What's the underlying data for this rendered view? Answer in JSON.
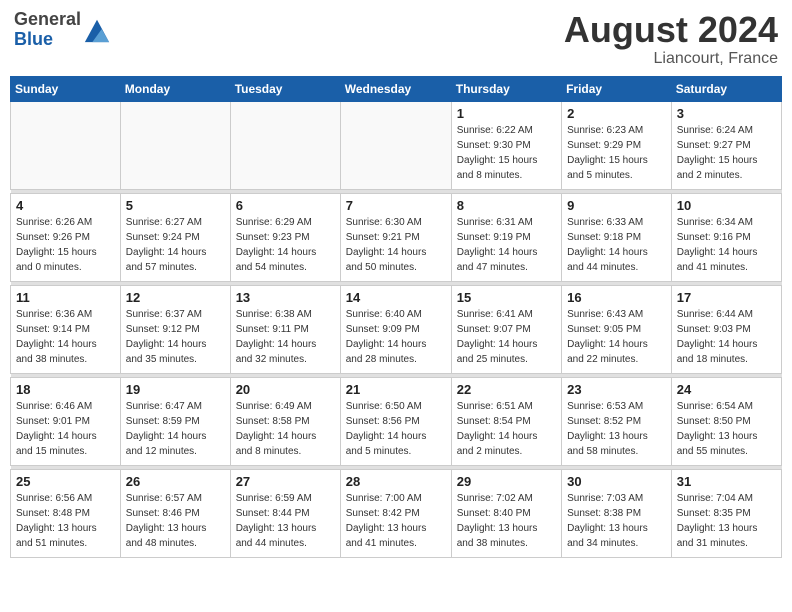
{
  "header": {
    "logo_line1": "General",
    "logo_line2": "Blue",
    "month_year": "August 2024",
    "location": "Liancourt, France"
  },
  "days_of_week": [
    "Sunday",
    "Monday",
    "Tuesday",
    "Wednesday",
    "Thursday",
    "Friday",
    "Saturday"
  ],
  "weeks": [
    [
      {
        "day": "",
        "info": ""
      },
      {
        "day": "",
        "info": ""
      },
      {
        "day": "",
        "info": ""
      },
      {
        "day": "",
        "info": ""
      },
      {
        "day": "1",
        "info": "Sunrise: 6:22 AM\nSunset: 9:30 PM\nDaylight: 15 hours\nand 8 minutes."
      },
      {
        "day": "2",
        "info": "Sunrise: 6:23 AM\nSunset: 9:29 PM\nDaylight: 15 hours\nand 5 minutes."
      },
      {
        "day": "3",
        "info": "Sunrise: 6:24 AM\nSunset: 9:27 PM\nDaylight: 15 hours\nand 2 minutes."
      }
    ],
    [
      {
        "day": "4",
        "info": "Sunrise: 6:26 AM\nSunset: 9:26 PM\nDaylight: 15 hours\nand 0 minutes."
      },
      {
        "day": "5",
        "info": "Sunrise: 6:27 AM\nSunset: 9:24 PM\nDaylight: 14 hours\nand 57 minutes."
      },
      {
        "day": "6",
        "info": "Sunrise: 6:29 AM\nSunset: 9:23 PM\nDaylight: 14 hours\nand 54 minutes."
      },
      {
        "day": "7",
        "info": "Sunrise: 6:30 AM\nSunset: 9:21 PM\nDaylight: 14 hours\nand 50 minutes."
      },
      {
        "day": "8",
        "info": "Sunrise: 6:31 AM\nSunset: 9:19 PM\nDaylight: 14 hours\nand 47 minutes."
      },
      {
        "day": "9",
        "info": "Sunrise: 6:33 AM\nSunset: 9:18 PM\nDaylight: 14 hours\nand 44 minutes."
      },
      {
        "day": "10",
        "info": "Sunrise: 6:34 AM\nSunset: 9:16 PM\nDaylight: 14 hours\nand 41 minutes."
      }
    ],
    [
      {
        "day": "11",
        "info": "Sunrise: 6:36 AM\nSunset: 9:14 PM\nDaylight: 14 hours\nand 38 minutes."
      },
      {
        "day": "12",
        "info": "Sunrise: 6:37 AM\nSunset: 9:12 PM\nDaylight: 14 hours\nand 35 minutes."
      },
      {
        "day": "13",
        "info": "Sunrise: 6:38 AM\nSunset: 9:11 PM\nDaylight: 14 hours\nand 32 minutes."
      },
      {
        "day": "14",
        "info": "Sunrise: 6:40 AM\nSunset: 9:09 PM\nDaylight: 14 hours\nand 28 minutes."
      },
      {
        "day": "15",
        "info": "Sunrise: 6:41 AM\nSunset: 9:07 PM\nDaylight: 14 hours\nand 25 minutes."
      },
      {
        "day": "16",
        "info": "Sunrise: 6:43 AM\nSunset: 9:05 PM\nDaylight: 14 hours\nand 22 minutes."
      },
      {
        "day": "17",
        "info": "Sunrise: 6:44 AM\nSunset: 9:03 PM\nDaylight: 14 hours\nand 18 minutes."
      }
    ],
    [
      {
        "day": "18",
        "info": "Sunrise: 6:46 AM\nSunset: 9:01 PM\nDaylight: 14 hours\nand 15 minutes."
      },
      {
        "day": "19",
        "info": "Sunrise: 6:47 AM\nSunset: 8:59 PM\nDaylight: 14 hours\nand 12 minutes."
      },
      {
        "day": "20",
        "info": "Sunrise: 6:49 AM\nSunset: 8:58 PM\nDaylight: 14 hours\nand 8 minutes."
      },
      {
        "day": "21",
        "info": "Sunrise: 6:50 AM\nSunset: 8:56 PM\nDaylight: 14 hours\nand 5 minutes."
      },
      {
        "day": "22",
        "info": "Sunrise: 6:51 AM\nSunset: 8:54 PM\nDaylight: 14 hours\nand 2 minutes."
      },
      {
        "day": "23",
        "info": "Sunrise: 6:53 AM\nSunset: 8:52 PM\nDaylight: 13 hours\nand 58 minutes."
      },
      {
        "day": "24",
        "info": "Sunrise: 6:54 AM\nSunset: 8:50 PM\nDaylight: 13 hours\nand 55 minutes."
      }
    ],
    [
      {
        "day": "25",
        "info": "Sunrise: 6:56 AM\nSunset: 8:48 PM\nDaylight: 13 hours\nand 51 minutes."
      },
      {
        "day": "26",
        "info": "Sunrise: 6:57 AM\nSunset: 8:46 PM\nDaylight: 13 hours\nand 48 minutes."
      },
      {
        "day": "27",
        "info": "Sunrise: 6:59 AM\nSunset: 8:44 PM\nDaylight: 13 hours\nand 44 minutes."
      },
      {
        "day": "28",
        "info": "Sunrise: 7:00 AM\nSunset: 8:42 PM\nDaylight: 13 hours\nand 41 minutes."
      },
      {
        "day": "29",
        "info": "Sunrise: 7:02 AM\nSunset: 8:40 PM\nDaylight: 13 hours\nand 38 minutes."
      },
      {
        "day": "30",
        "info": "Sunrise: 7:03 AM\nSunset: 8:38 PM\nDaylight: 13 hours\nand 34 minutes."
      },
      {
        "day": "31",
        "info": "Sunrise: 7:04 AM\nSunset: 8:35 PM\nDaylight: 13 hours\nand 31 minutes."
      }
    ]
  ]
}
